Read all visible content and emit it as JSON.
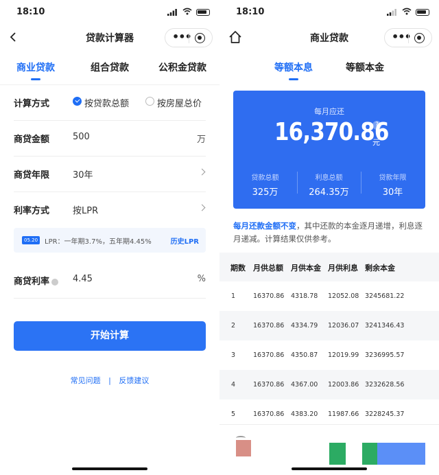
{
  "status_bar": {
    "time": "18:10"
  },
  "left": {
    "nav_title": "贷款计算器",
    "tabs": [
      {
        "label": "商业贷款",
        "active": true
      },
      {
        "label": "组合贷款",
        "active": false
      },
      {
        "label": "公积金贷款",
        "active": false
      }
    ],
    "calc_method": {
      "label": "计算方式",
      "options": [
        {
          "label": "按贷款总额",
          "checked": true
        },
        {
          "label": "按房屋总价",
          "checked": false
        }
      ]
    },
    "amount": {
      "label": "商贷金额",
      "value": "500",
      "unit": "万"
    },
    "years": {
      "label": "商贷年限",
      "value": "30年"
    },
    "rate_method": {
      "label": "利率方式",
      "value": "按LPR"
    },
    "lpr": {
      "badge": "05.20",
      "info": "LPR：一年期3.7%，五年期4.45%",
      "link": "历史LPR"
    },
    "rate": {
      "label": "商贷利率",
      "value": "4.45",
      "unit": "%"
    },
    "start_button": "开始计算",
    "links": {
      "faq": "常见问题",
      "separator": "|",
      "feedback": "反馈建议"
    }
  },
  "right": {
    "nav_title": "商业贷款",
    "tabs": [
      {
        "label": "等额本息",
        "active": true
      },
      {
        "label": "等额本金",
        "active": false
      }
    ],
    "monthly_caption": "每月应还",
    "monthly_amount": "16,370.86",
    "monthly_unit": "元",
    "help_glyph": "?",
    "stats": [
      {
        "label": "贷款总额",
        "value": "325万"
      },
      {
        "label": "利息总额",
        "value": "264.35万"
      },
      {
        "label": "贷款年限",
        "value": "30年"
      }
    ],
    "note_emphasis": "每月还款金额不变",
    "note_rest": "，其中还款的本金逐月递增，利息逐月递减。计算结果仅供参考。",
    "table": {
      "headers": [
        "期数",
        "月供总额",
        "月供本金",
        "月供利息",
        "剩余本金"
      ],
      "rows": [
        [
          "1",
          "16370.86",
          "4318.78",
          "12052.08",
          "3245681.22"
        ],
        [
          "2",
          "16370.86",
          "4334.79",
          "12036.07",
          "3241346.43"
        ],
        [
          "3",
          "16370.86",
          "4350.87",
          "12019.99",
          "3236995.57"
        ],
        [
          "4",
          "16370.86",
          "4367.00",
          "12003.86",
          "3232628.56"
        ],
        [
          "5",
          "16370.86",
          "4383.20",
          "11987.66",
          "3228245.37"
        ]
      ]
    }
  },
  "colors": {
    "accent": "#1f6ef5",
    "card": "#2f6df0",
    "row_alt": "#f5f6f8"
  }
}
